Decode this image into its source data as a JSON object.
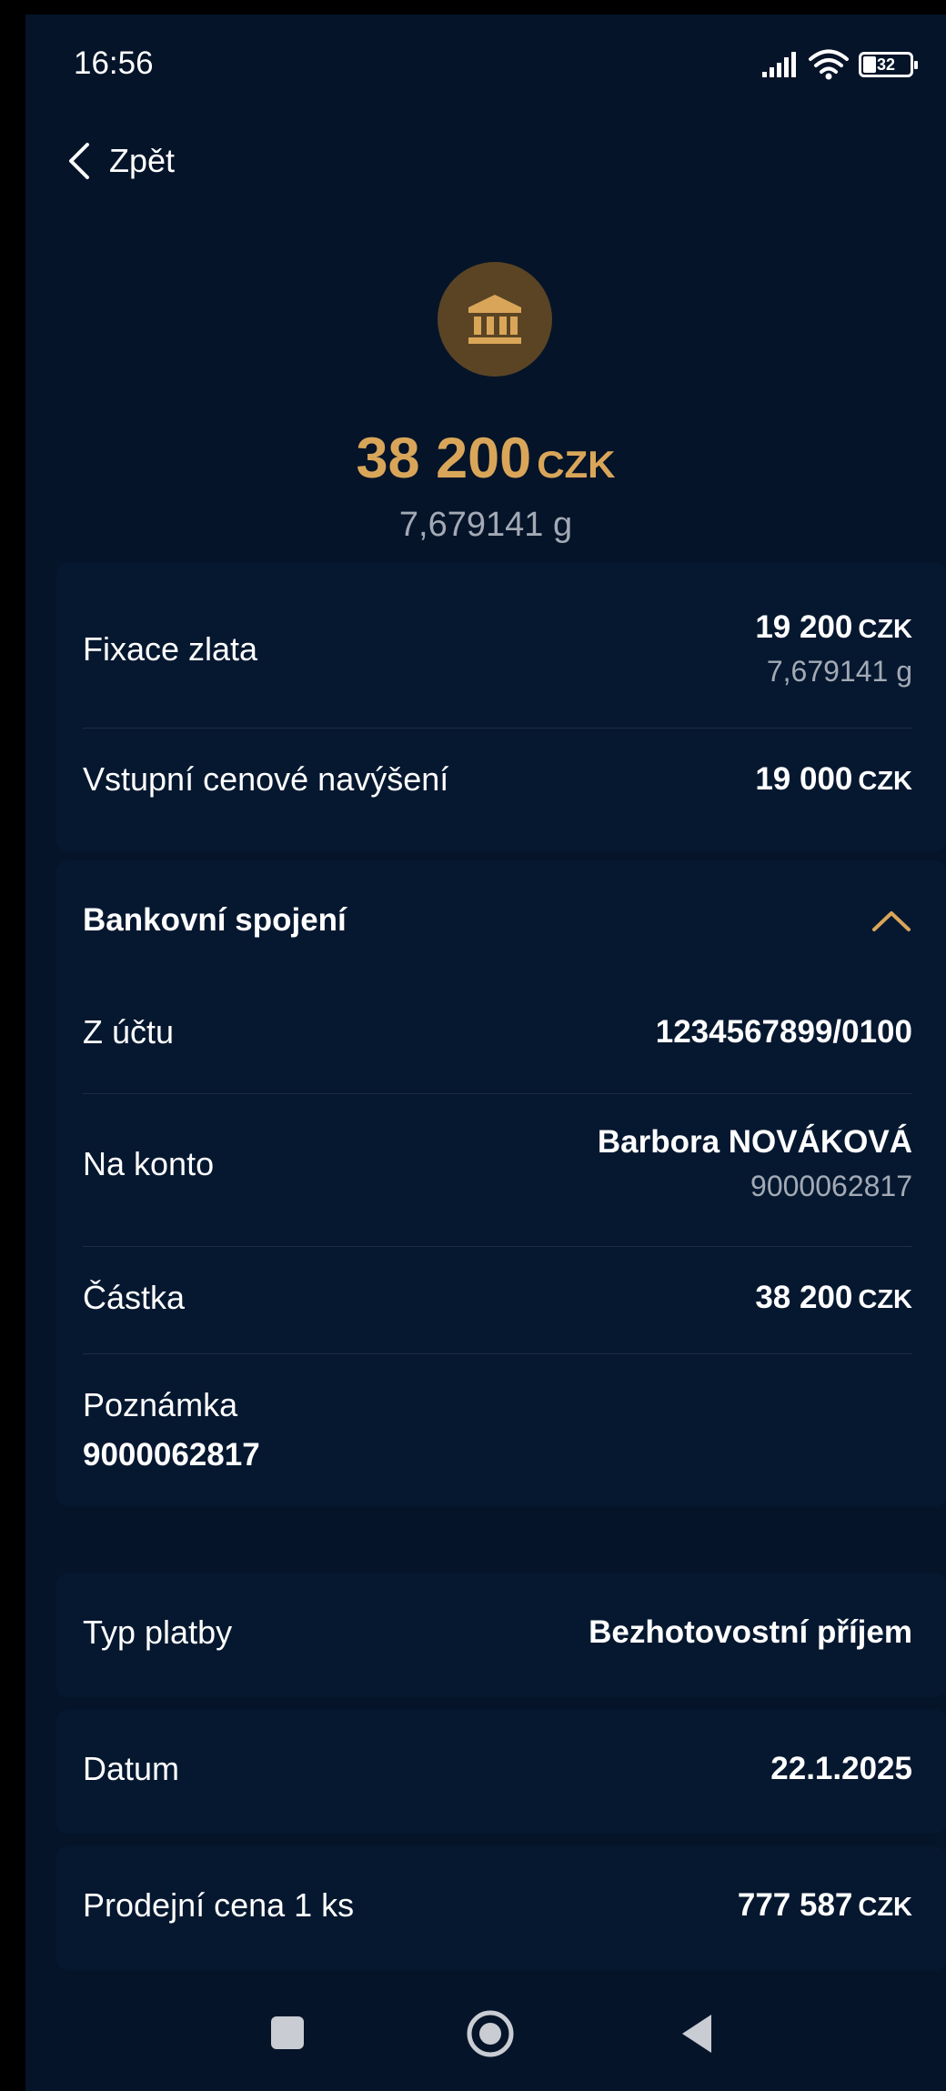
{
  "status": {
    "time": "16:56",
    "battery": "32"
  },
  "nav": {
    "back_label": "Zpět"
  },
  "hero": {
    "amount": "38 200",
    "currency": "CZK",
    "grams": "7,679141 g"
  },
  "summary": {
    "fixation": {
      "label": "Fixace zlata",
      "amount": "19 200",
      "currency": "CZK",
      "grams": "7,679141 g"
    },
    "fee": {
      "label": "Vstupní cenové navýšení",
      "amount": "19 000",
      "currency": "CZK"
    }
  },
  "bank": {
    "title": "Bankovní spojení",
    "from": {
      "label": "Z účtu",
      "value": "1234567899/0100"
    },
    "to": {
      "label": "Na konto",
      "name": "Barbora NOVÁKOVÁ",
      "account": "9000062817"
    },
    "amount": {
      "label": "Částka",
      "value": "38 200",
      "currency": "CZK"
    },
    "note": {
      "label": "Poznámka",
      "value": "9000062817"
    }
  },
  "details": {
    "payment_type": {
      "label": "Typ platby",
      "value": "Bezhotovostní příjem"
    },
    "date": {
      "label": "Datum",
      "value": "22.1.2025"
    },
    "price": {
      "label": "Prodejní cena 1 ks",
      "value": "777 587",
      "currency": "CZK"
    }
  },
  "colors": {
    "background": "#051429",
    "card": "#061830",
    "accent": "#d9a659",
    "muted": "#a3aab5"
  },
  "icons": {
    "hero": "bank-icon",
    "collapse": "chevron-up-icon",
    "back": "chevron-left-icon"
  }
}
